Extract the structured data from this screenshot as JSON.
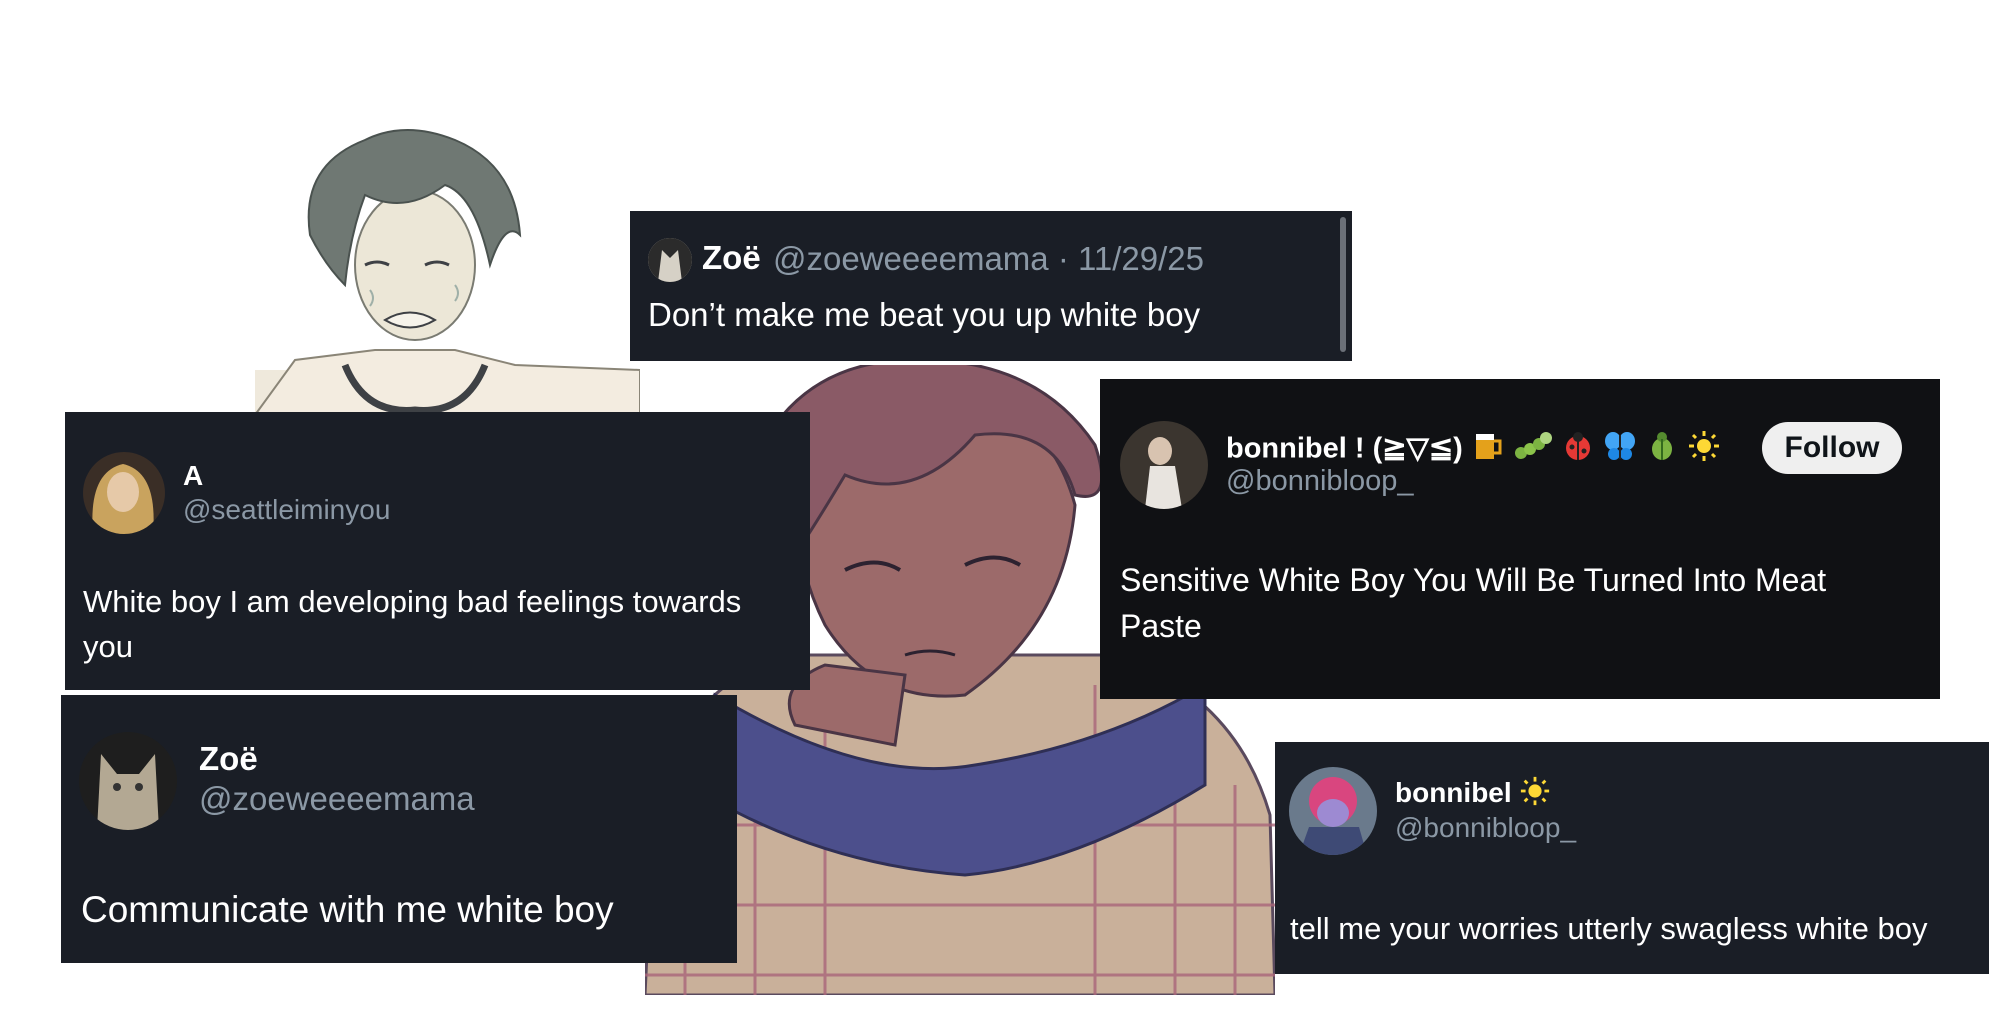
{
  "tweets": [
    {
      "name": "Zoë",
      "handle": "@zoeweeeemama",
      "date": "· 11/29/25",
      "text": "Don’t make me beat you up white boy"
    },
    {
      "name": "A",
      "handle": "@seattleiminyou",
      "text": "White boy I am developing bad feelings towards you"
    },
    {
      "name": "bonnibel ! (≧▽≦)",
      "handle": "@bonnibloop_",
      "text": "Sensitive White Boy You Will Be Turned Into Meat Paste",
      "follow_label": "Follow"
    },
    {
      "name": "Zoë",
      "handle": "@zoeweeeemama",
      "text": "Communicate with me white boy"
    },
    {
      "name": "bonnibel",
      "handle": "@bonnibloop_",
      "text": "tell me your worries utterly swagless white boy"
    }
  ],
  "icons": [
    "beer-mug-icon",
    "caterpillar-icon",
    "ladybug-icon",
    "butterfly-icon",
    "beetle-icon",
    "sun-icon"
  ],
  "colors": {
    "card_bg": "#1a1e26",
    "handle": "#8b98a5",
    "follow_bg": "#efefef"
  }
}
